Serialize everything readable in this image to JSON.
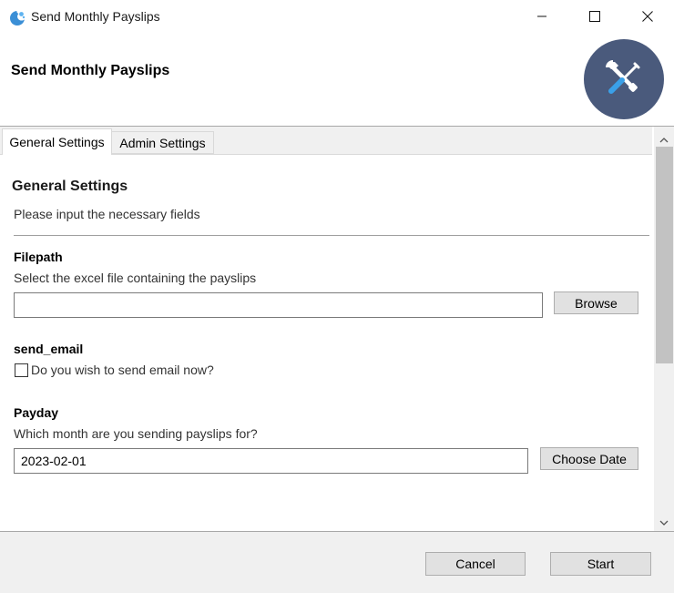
{
  "window": {
    "title": "Send Monthly Payslips",
    "app_icon": "python-icon",
    "controls": {
      "minimize": "minimize-icon",
      "maximize": "maximize-icon",
      "close": "close-icon"
    }
  },
  "header": {
    "title": "Send Monthly Payslips",
    "badge_icon": "tools-icon",
    "badge_color": "#4a5a7c"
  },
  "tabs": [
    {
      "label": "General Settings",
      "active": true
    },
    {
      "label": "Admin Settings",
      "active": false
    }
  ],
  "section": {
    "title": "General Settings",
    "description": "Please input the necessary fields"
  },
  "fields": {
    "filepath": {
      "label": "Filepath",
      "help": "Select the excel file containing the payslips",
      "value": "",
      "button": "Browse"
    },
    "send_email": {
      "label": "send_email",
      "checkbox_label": "Do you wish to send email now?",
      "checked": false
    },
    "payday": {
      "label": "Payday",
      "help": "Which month are you sending payslips for?",
      "value": "2023-02-01",
      "button": "Choose Date"
    }
  },
  "footer": {
    "cancel": "Cancel",
    "start": "Start"
  }
}
